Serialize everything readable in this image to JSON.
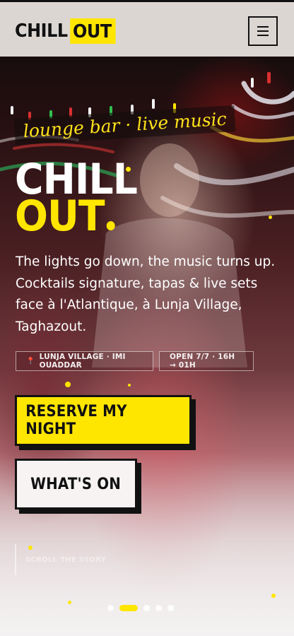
{
  "header": {
    "logo_part1": "CHILL",
    "logo_part2": "OUT",
    "menu_icon": "hamburger-icon"
  },
  "hero": {
    "tagline": "lounge bar · live music",
    "title_line1": "CHILL",
    "title_line2": "OUT",
    "lead": "The lights go down, the music turns up. Cocktails signature, tapas & live sets face à l'Atlantique, à Lunja Village, Taghazout.",
    "badges": {
      "location_icon": "map-pin-icon",
      "location": "LUNJA VILLAGE · IMI OUADDAR",
      "hours": "OPEN 7/7 · 16H → 01H"
    },
    "buttons": {
      "reserve": "RESERVE MY NIGHT",
      "whats_on": "WHAT'S ON"
    },
    "scroll_label": "SCROLL THE STORY",
    "slides": {
      "count": 5,
      "active": 1
    }
  },
  "colors": {
    "accent": "#ffe600",
    "ink": "#111111",
    "header_bg": "#dcd6d3"
  }
}
